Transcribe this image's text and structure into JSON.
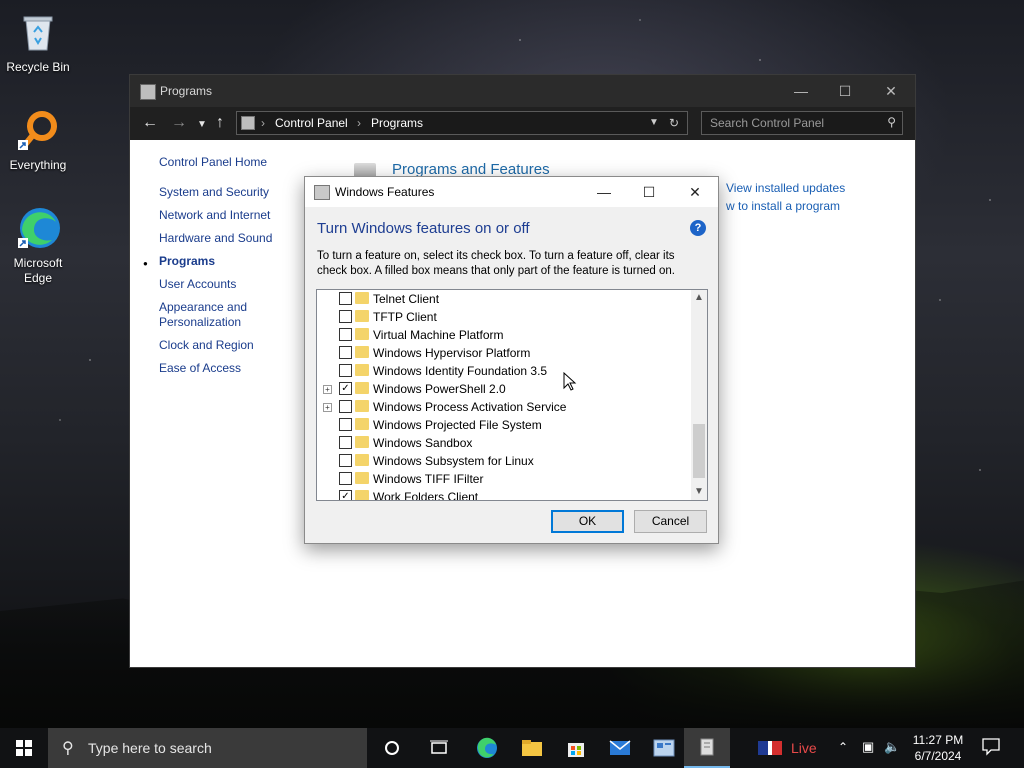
{
  "desktop": {
    "icons": [
      {
        "label": "Recycle Bin"
      },
      {
        "label": "Everything"
      },
      {
        "label": "Microsoft Edge"
      }
    ]
  },
  "window": {
    "title": "Programs",
    "breadcrumbs": [
      "Control Panel",
      "Programs"
    ],
    "search_placeholder": "Search Control Panel",
    "nav_home": "Control Panel Home",
    "nav_items": [
      "System and Security",
      "Network and Internet",
      "Hardware and Sound",
      "Programs",
      "User Accounts",
      "Appearance and Personalization",
      "Clock and Region",
      "Ease of Access"
    ],
    "current_nav": "Programs",
    "section_title": "Programs and Features",
    "links": [
      "View installed updates",
      "w to install a program"
    ]
  },
  "dialog": {
    "title": "Windows Features",
    "heading": "Turn Windows features on or off",
    "description": "To turn a feature on, select its check box. To turn a feature off, clear its check box. A filled box means that only part of the feature is turned on.",
    "features": [
      {
        "name": "Telnet Client",
        "checked": false,
        "expandable": false
      },
      {
        "name": "TFTP Client",
        "checked": false,
        "expandable": false
      },
      {
        "name": "Virtual Machine Platform",
        "checked": false,
        "expandable": false
      },
      {
        "name": "Windows Hypervisor Platform",
        "checked": false,
        "expandable": false
      },
      {
        "name": "Windows Identity Foundation 3.5",
        "checked": false,
        "expandable": false
      },
      {
        "name": "Windows PowerShell 2.0",
        "checked": true,
        "expandable": true
      },
      {
        "name": "Windows Process Activation Service",
        "checked": false,
        "expandable": true
      },
      {
        "name": "Windows Projected File System",
        "checked": false,
        "expandable": false
      },
      {
        "name": "Windows Sandbox",
        "checked": false,
        "expandable": false
      },
      {
        "name": "Windows Subsystem for Linux",
        "checked": false,
        "expandable": false
      },
      {
        "name": "Windows TIFF IFilter",
        "checked": false,
        "expandable": false
      },
      {
        "name": "Work Folders Client",
        "checked": true,
        "expandable": false
      }
    ],
    "ok_label": "OK",
    "cancel_label": "Cancel"
  },
  "taskbar": {
    "search_placeholder": "Type here to search",
    "live_label": "Live",
    "time": "11:27 PM",
    "date": "6/7/2024"
  },
  "colors": {
    "link": "#1a5fb4",
    "heading": "#1e3e92",
    "accent": "#0078d7"
  }
}
